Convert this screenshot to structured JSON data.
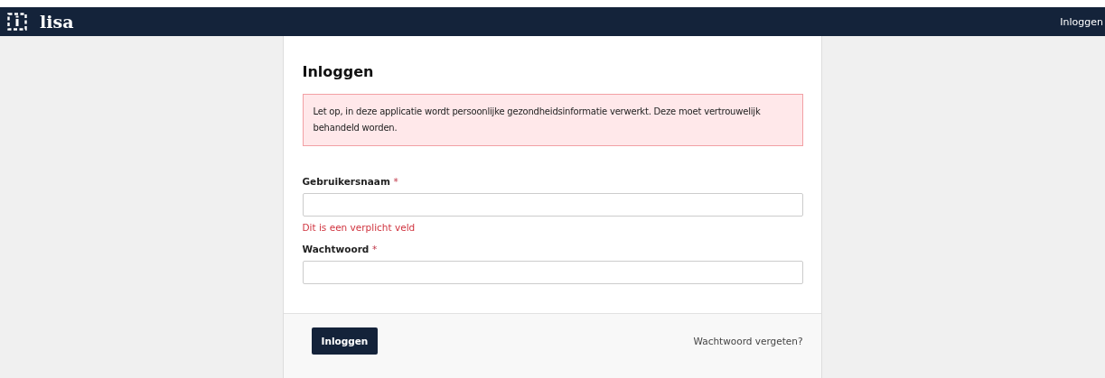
{
  "navbar": {
    "brand": "lisa",
    "login_link": "Inloggen"
  },
  "login_card": {
    "title": "Inloggen",
    "warning": "Let op, in deze applicatie wordt persoonlijke gezondheidsinformatie verwerkt. Deze moet vertrouwelijk behandeld worden.",
    "fields": [
      {
        "label": "Gebruikersnaam",
        "required_mark": "*",
        "error": "Dit is een verplicht veld"
      },
      {
        "label": "Wachtwoord",
        "required_mark": "*"
      }
    ],
    "submit_button": "Inloggen",
    "forgot_link": "Wachtwoord vergeten?"
  }
}
